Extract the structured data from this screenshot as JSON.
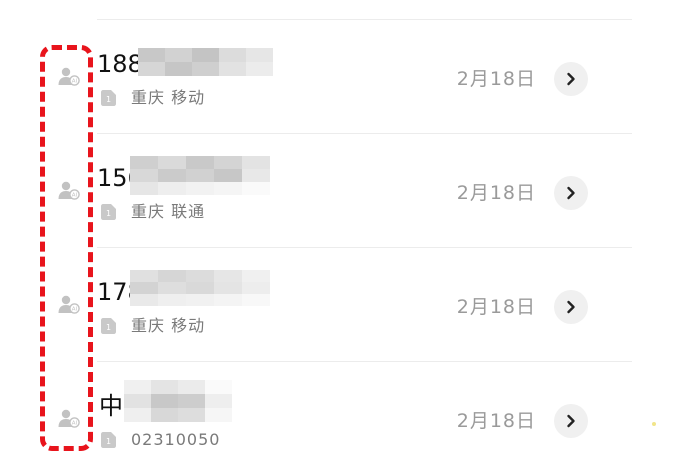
{
  "calls": [
    {
      "number": "188",
      "location": "重庆 移动",
      "date": "2月18日"
    },
    {
      "number": "156",
      "location": "重庆 联通",
      "date": "2月18日"
    },
    {
      "number": "178",
      "location": "重庆 移动",
      "date": "2月18日"
    },
    {
      "number": "中",
      "location": "02310050",
      "date": "2月18日"
    }
  ],
  "icons": {
    "avatar": "person-ai-icon",
    "sim": "sim-card-icon",
    "detail": "chevron-right-icon"
  },
  "colors": {
    "highlight": "#e8141c",
    "secondary_text": "#7a7a7a",
    "date_text": "#9a9a9a"
  }
}
